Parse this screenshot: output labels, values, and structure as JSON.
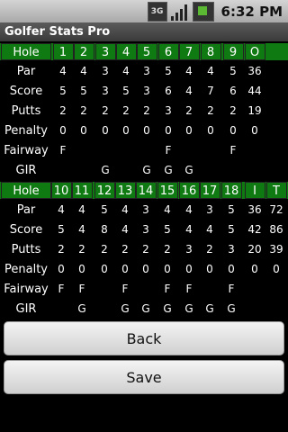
{
  "status": {
    "network": "3G",
    "time": "6:32 PM"
  },
  "app_title": "Golfer Stats Pro",
  "front": {
    "hole_label": "Hole",
    "holes": [
      "1",
      "2",
      "3",
      "4",
      "5",
      "6",
      "7",
      "8",
      "9",
      "O"
    ],
    "rows": [
      {
        "label": "Par",
        "values": [
          "4",
          "4",
          "3",
          "4",
          "3",
          "5",
          "4",
          "4",
          "5",
          "36"
        ]
      },
      {
        "label": "Score",
        "values": [
          "5",
          "5",
          "3",
          "5",
          "3",
          "6",
          "4",
          "7",
          "6",
          "44"
        ]
      },
      {
        "label": "Putts",
        "values": [
          "2",
          "2",
          "2",
          "2",
          "2",
          "3",
          "2",
          "2",
          "2",
          "19"
        ]
      },
      {
        "label": "Penalty",
        "values": [
          "0",
          "0",
          "0",
          "0",
          "0",
          "0",
          "0",
          "0",
          "0",
          "0"
        ]
      },
      {
        "label": "Fairway",
        "values": [
          "F",
          "",
          "",
          "",
          "",
          "F",
          "",
          "",
          "F",
          ""
        ]
      },
      {
        "label": "GIR",
        "values": [
          "",
          "",
          "G",
          "",
          "G",
          "G",
          "G",
          "",
          "",
          ""
        ]
      }
    ]
  },
  "back": {
    "hole_label": "Hole",
    "holes": [
      "10",
      "11",
      "12",
      "13",
      "14",
      "15",
      "16",
      "17",
      "18",
      "I",
      "T"
    ],
    "rows": [
      {
        "label": "Par",
        "values": [
          "4",
          "4",
          "5",
          "4",
          "3",
          "4",
          "4",
          "3",
          "5",
          "36",
          "72"
        ]
      },
      {
        "label": "Score",
        "values": [
          "5",
          "4",
          "8",
          "4",
          "3",
          "5",
          "4",
          "4",
          "5",
          "42",
          "86"
        ]
      },
      {
        "label": "Putts",
        "values": [
          "2",
          "2",
          "2",
          "2",
          "2",
          "2",
          "3",
          "2",
          "3",
          "20",
          "39"
        ]
      },
      {
        "label": "Penalty",
        "values": [
          "0",
          "0",
          "0",
          "0",
          "0",
          "0",
          "0",
          "0",
          "0",
          "0",
          "0"
        ]
      },
      {
        "label": "Fairway",
        "values": [
          "F",
          "F",
          "",
          "F",
          "",
          "F",
          "F",
          "",
          "F",
          "",
          ""
        ]
      },
      {
        "label": "GIR",
        "values": [
          "",
          "G",
          "",
          "G",
          "G",
          "G",
          "G",
          "G",
          "G",
          "",
          ""
        ]
      }
    ]
  },
  "buttons": {
    "back": "Back",
    "save": "Save"
  },
  "colors": {
    "header_green": "#0f7a12",
    "background": "#000000"
  }
}
